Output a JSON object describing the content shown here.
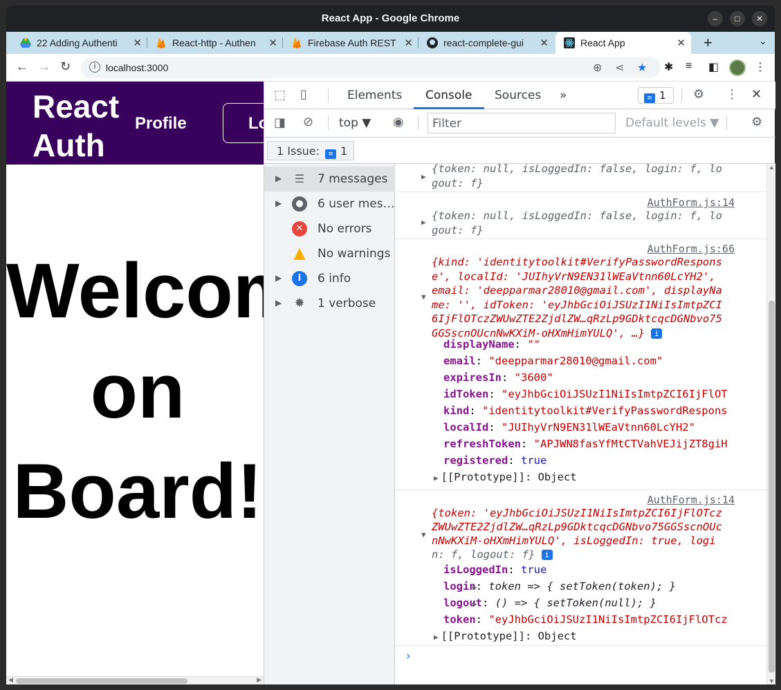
{
  "window": {
    "title": "React App - Google Chrome"
  },
  "tabs": [
    {
      "label": "22 Adding Authenti",
      "icon": "google-drive-icon"
    },
    {
      "label": "React-http - Authen",
      "icon": "firebase-icon"
    },
    {
      "label": "Firebase Auth REST",
      "icon": "firebase-icon"
    },
    {
      "label": "react-complete-gui",
      "icon": "github-icon"
    },
    {
      "label": "React App",
      "icon": "react-icon",
      "active": true
    }
  ],
  "address": {
    "url": "localhost:3000"
  },
  "app": {
    "logo_line1": "React",
    "logo_line2": "Auth",
    "nav_profile": "Profile",
    "nav_logout": "Logout",
    "welcome_line1": "Welcome",
    "welcome_line2": "on",
    "welcome_line3": "Board!"
  },
  "devtools": {
    "tabs": [
      "Elements",
      "Console",
      "Sources"
    ],
    "more": "»",
    "issues_count": "1",
    "context": "top ▼",
    "filter_placeholder": "Filter",
    "levels": "Default levels ▼",
    "issue_chip_label": "1 Issue:",
    "issue_chip_count": "1",
    "sidebar": [
      {
        "label": "7 messages",
        "icon": "list-icon"
      },
      {
        "label": "6 user mes…",
        "icon": "user-icon"
      },
      {
        "label": "No errors",
        "icon": "error-icon"
      },
      {
        "label": "No warnings",
        "icon": "warning-icon"
      },
      {
        "label": "6 info",
        "icon": "info-icon"
      },
      {
        "label": "1 verbose",
        "icon": "bug-icon"
      }
    ],
    "console": {
      "src_authform14": "AuthForm.js:14",
      "src_authform66": "AuthForm.js:66",
      "e1_line1": "{token: null, isLoggedIn: false, login: f, lo",
      "e1_line2": "gout: f}",
      "e2_line1": "{token: null, isLoggedIn: false, login: f, lo",
      "e2_line2": "gout: f}",
      "e3_lines": [
        "{kind: 'identitytoolkit#VerifyPasswordRespons",
        "e', localId: 'JUIhyVrN9EN31lWEaVtnn60LcYH2',",
        "email: 'deepparmar28010@gmail.com', displayNa",
        "me: '', idToken: 'eyJhbGciOiJSUzI1NiIsImtpZCI",
        "6IjFlOTczZWUwZTE2ZjdlZW…qRzLp9GDktcqcDGNbvo75",
        "GGSscnOUcnNwKXiM-oHXmHimYULQ', …}"
      ],
      "e3_props": [
        {
          "name": "displayName",
          "value": "\"\""
        },
        {
          "name": "email",
          "value": "\"deepparmar28010@gmail.com\""
        },
        {
          "name": "expiresIn",
          "value": "\"3600\""
        },
        {
          "name": "idToken",
          "value": "\"eyJhbGciOiJSUzI1NiIsImtpZCI6IjFlOT"
        },
        {
          "name": "kind",
          "value": "\"identitytoolkit#VerifyPasswordRespons"
        },
        {
          "name": "localId",
          "value": "\"JUIhyVrN9EN31lWEaVtnn60LcYH2\""
        },
        {
          "name": "refreshToken",
          "value": "\"APJWN8fasYfMtCTVahVEJijZT8giH"
        },
        {
          "name": "registered",
          "value": "true"
        }
      ],
      "proto_label": "[[Prototype]]: Object",
      "e4_lines": [
        "{token: 'eyJhbGciOiJSUzI1NiIsImtpZCI6IjFlOTcz",
        "ZWUwZTE2ZjdlZW…qRzLp9GDktcqcDGNbvo75GGSscnOUc",
        "nNwKXiM-oHXmHimYULQ', isLoggedIn: true, logi",
        "n: f, logout: f}"
      ],
      "e4_props": [
        {
          "name": "isLoggedIn",
          "value": "true"
        },
        {
          "name": "login",
          "value": "token => { setToken(token); }"
        },
        {
          "name": "logout",
          "value": "() => { setToken(null); }"
        },
        {
          "name": "token",
          "value": "\"eyJhbGciOiJSUzI1NiIsImtpZCI6IjFlOTcz"
        }
      ],
      "info_badge": "i",
      "prompt": "›"
    }
  },
  "colors": {
    "app_header": "#38015c",
    "tab_strip": "#c5e0ec",
    "accent": "#1a73e8"
  }
}
